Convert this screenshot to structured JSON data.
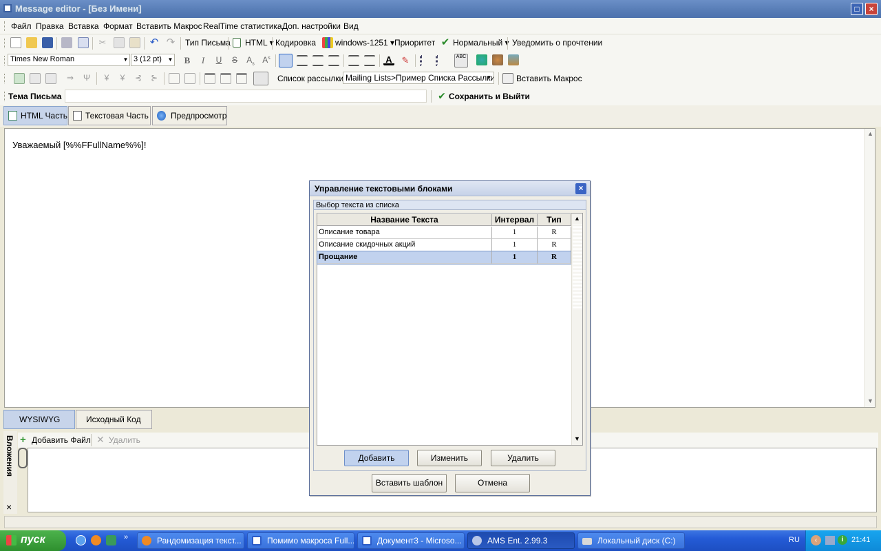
{
  "window": {
    "title": "Message editor - [Без Имени]"
  },
  "menu": [
    "Файл",
    "Правка",
    "Вставка",
    "Формат",
    "Вставить Макрос",
    "RealTime статистика",
    "Доп. настройки",
    "Вид"
  ],
  "toolbar1": {
    "letter_type": "Тип Письма",
    "format": "HTML",
    "encoding_label": "Кодировка",
    "encoding": "windows-1251",
    "priority_label": "Приоритет",
    "priority": "Нормальный",
    "notify": "Уведомить о прочтении"
  },
  "toolbar2": {
    "font": "Times New Roman",
    "size": "3  (12 pt)"
  },
  "toolbar3": {
    "list_label": "Список рассылки",
    "list_value": "Mailing Lists>Пример Списка Рассылки",
    "insert_macro": "Вставить Макрос"
  },
  "subject": {
    "label": "Тема Письма",
    "value": "",
    "save_exit": "Сохранить и Выйти"
  },
  "tabs": [
    "HTML Часть",
    "Текстовая Часть",
    "Предпросмотр"
  ],
  "editor": {
    "content": "Уважаемый [%%FFullName%%]!"
  },
  "view_tabs": [
    "WYSIWYG",
    "Исходный Код"
  ],
  "attachments": {
    "add": "Добавить Файл",
    "delete": "Удалить",
    "side_label": "Вложения",
    "close": "×"
  },
  "dialog": {
    "title": "Управление текстовыми блоками",
    "group_label": "Выбор текста из списка",
    "columns": [
      "Название Текста",
      "Интервал",
      "Тип"
    ],
    "rows": [
      {
        "name": "Описание товара",
        "interval": "1",
        "type": "R"
      },
      {
        "name": "Описание скидочных акций",
        "interval": "1",
        "type": "R"
      },
      {
        "name": "Прощание",
        "interval": "1",
        "type": "R"
      }
    ],
    "selected_row": 2,
    "buttons": {
      "add": "Добавить",
      "edit": "Изменить",
      "delete": "Удалить",
      "insert": "Вставить шаблон",
      "cancel": "Отмена"
    }
  },
  "taskbar": {
    "start": "пуск",
    "windows": [
      "Рандомизация текст...",
      "Помимо макроса Full...",
      "Документ3 - Microso...",
      "AMS Ent. 2.99.3",
      "Локальный диск (C:)"
    ],
    "active_window": 3,
    "lang": "RU",
    "clock": "21:41"
  },
  "colors": {
    "accent": "#316ac5",
    "selection": "#c1d2ee",
    "titlebar": "#5a7fb8",
    "taskbar": "#245bd6",
    "start": "#2e8f2e"
  }
}
